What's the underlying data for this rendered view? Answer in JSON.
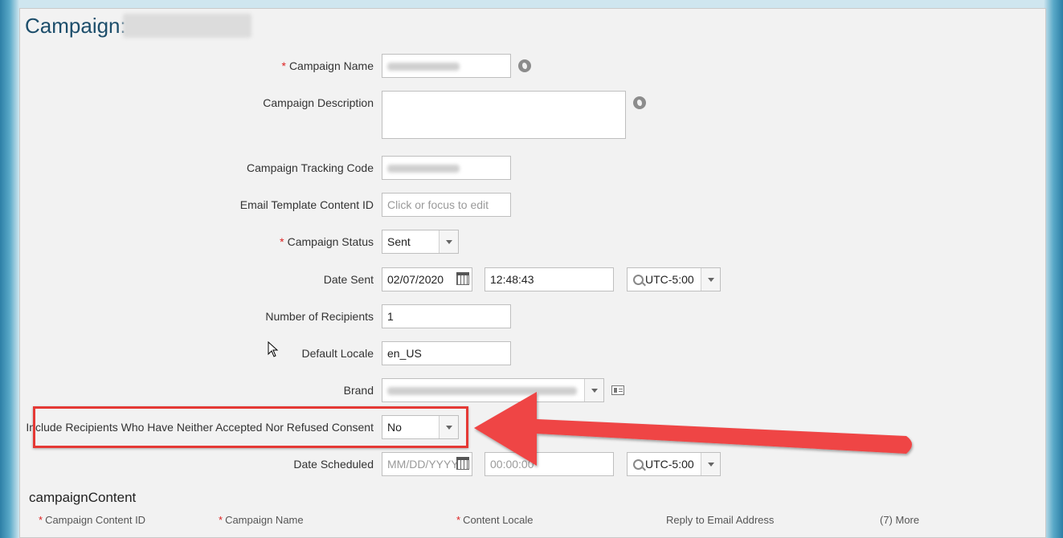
{
  "page": {
    "title_prefix": "Campaign:"
  },
  "form": {
    "campaign_name_label": "Campaign Name",
    "campaign_description_label": "Campaign Description",
    "tracking_code_label": "Campaign Tracking Code",
    "email_template_label": "Email Template Content ID",
    "email_template_placeholder": "Click or focus to edit",
    "status_label": "Campaign Status",
    "status_value": "Sent",
    "date_sent_label": "Date Sent",
    "date_sent_value": "02/07/2020",
    "time_sent_value": "12:48:43",
    "timezone_sent": "UTC-5:00",
    "recipients_label": "Number of Recipients",
    "recipients_value": "1",
    "locale_label": "Default Locale",
    "locale_value": "en_US",
    "brand_label": "Brand",
    "consent_label": "Include Recipients Who Have Neither Accepted Nor Refused Consent",
    "consent_value": "No",
    "date_scheduled_label": "Date Scheduled",
    "date_scheduled_placeholder": "MM/DD/YYYY",
    "time_scheduled_placeholder": "00:00:00",
    "timezone_scheduled": "UTC-5:00"
  },
  "content_section": {
    "title": "campaignContent",
    "columns": [
      "Campaign Content ID",
      "Campaign Name",
      "Content Locale",
      "Reply to Email Address",
      "(7) More"
    ]
  },
  "colors": {
    "accent_title": "#1d4e6b",
    "required": "#dd2222",
    "annotation": "#e53935"
  }
}
